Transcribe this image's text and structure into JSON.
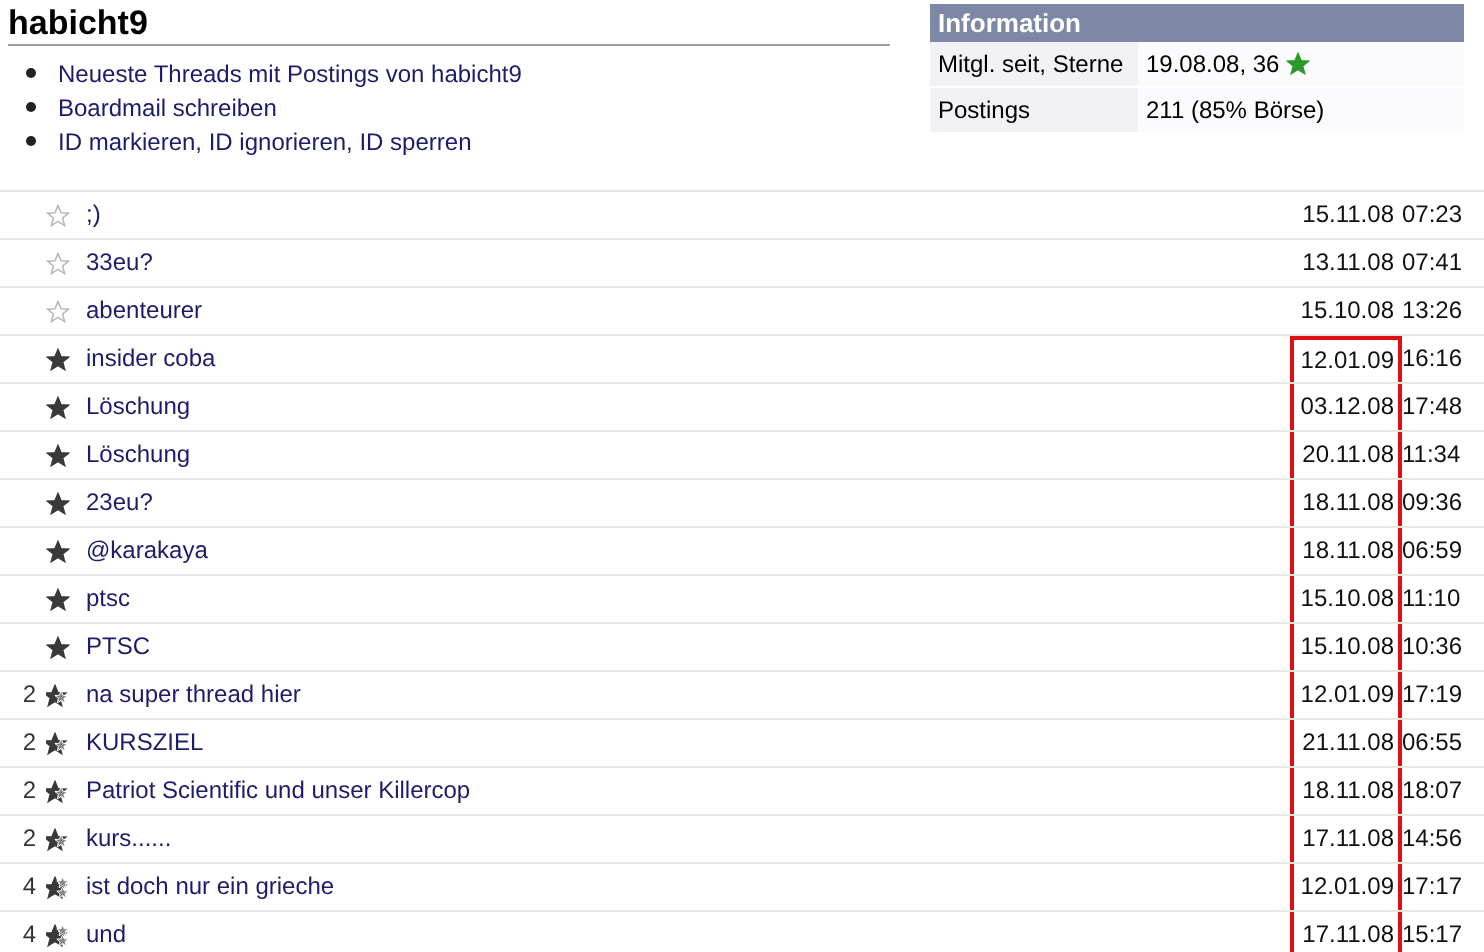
{
  "title": "habicht9",
  "links": [
    "Neueste Threads mit Postings von habicht9",
    "Boardmail schreiben",
    "ID markieren, ID ignorieren, ID sperren"
  ],
  "information": {
    "heading": "Information",
    "rows": [
      {
        "label": "Mitgl. seit, Sterne",
        "value": "19.08.08, 36",
        "star": true
      },
      {
        "label": "Postings",
        "value": "211 (85% Börse)",
        "star": false
      }
    ]
  },
  "threads": [
    {
      "kind": "outline",
      "title": ";)",
      "date": "15.11.08",
      "time": "07:23",
      "highlighted": false
    },
    {
      "kind": "outline",
      "title": "33eu?",
      "date": "13.11.08",
      "time": "07:41",
      "highlighted": false
    },
    {
      "kind": "outline",
      "title": "abenteurer",
      "date": "15.10.08",
      "time": "13:26",
      "highlighted": false
    },
    {
      "kind": "solid",
      "title": "insider coba",
      "date": "12.01.09",
      "time": "16:16",
      "highlighted": true
    },
    {
      "kind": "solid",
      "title": "Löschung",
      "date": "03.12.08",
      "time": "17:48",
      "highlighted": true
    },
    {
      "kind": "solid",
      "title": "Löschung",
      "date": "20.11.08",
      "time": "11:34",
      "highlighted": true
    },
    {
      "kind": "solid",
      "title": "23eu?",
      "date": "18.11.08",
      "time": "09:36",
      "highlighted": true
    },
    {
      "kind": "solid",
      "title": "@karakaya",
      "date": "18.11.08",
      "time": "06:59",
      "highlighted": true
    },
    {
      "kind": "solid",
      "title": "ptsc",
      "date": "15.10.08",
      "time": "11:10",
      "highlighted": true
    },
    {
      "kind": "solid",
      "title": "PTSC",
      "date": "15.10.08",
      "time": "10:36",
      "highlighted": true
    },
    {
      "count": "2",
      "kind": "double",
      "title": "na super thread hier",
      "date": "12.01.09",
      "time": "17:19",
      "highlighted": true
    },
    {
      "count": "2",
      "kind": "double",
      "title": "KURSZIEL",
      "date": "21.11.08",
      "time": "06:55",
      "highlighted": true
    },
    {
      "count": "2",
      "kind": "double",
      "title": "Patriot Scientific und unser Killercop",
      "date": "18.11.08",
      "time": "18:07",
      "highlighted": true
    },
    {
      "count": "2",
      "kind": "double",
      "title": "kurs......",
      "date": "17.11.08",
      "time": "14:56",
      "highlighted": true
    },
    {
      "count": "4",
      "kind": "triple",
      "title": "ist doch nur ein grieche",
      "date": "12.01.09",
      "time": "17:17",
      "highlighted": true
    },
    {
      "count": "4",
      "kind": "triple",
      "title": "und",
      "date": "17.11.08",
      "time": "15:17",
      "highlighted": true
    }
  ]
}
